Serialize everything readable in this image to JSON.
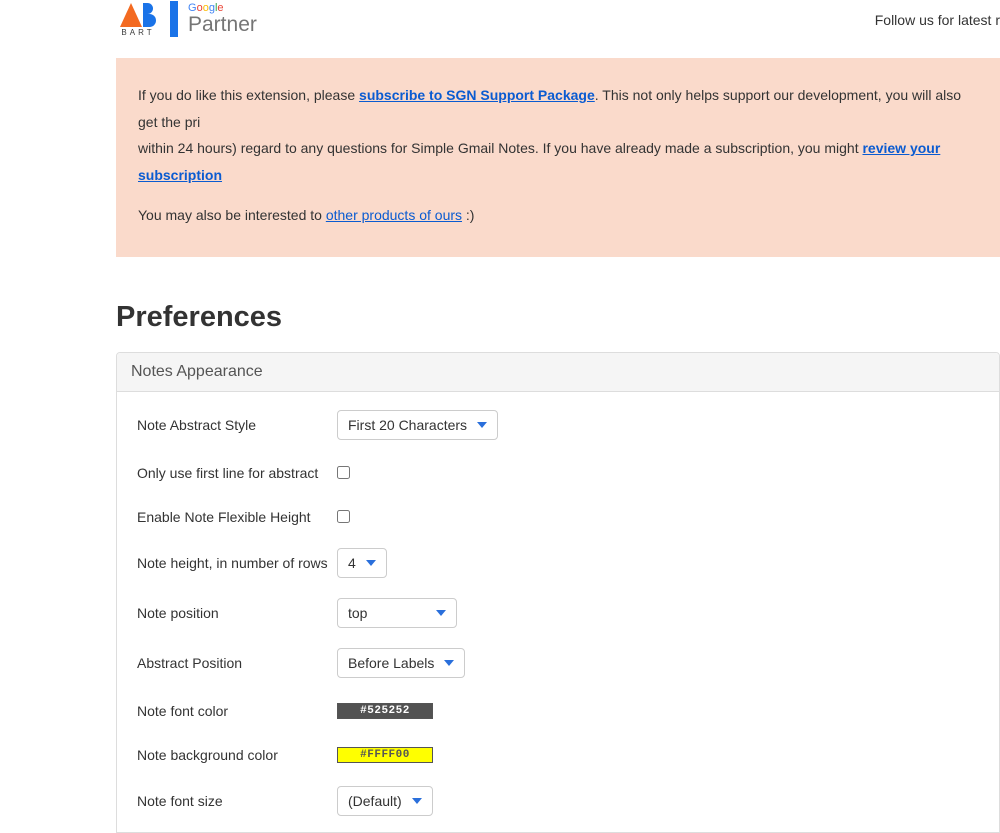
{
  "header": {
    "bart_label": "BART",
    "google_letters": [
      "G",
      "o",
      "o",
      "g",
      "l",
      "e"
    ],
    "partner_label": "Partner",
    "follow_text": "Follow us for latest r"
  },
  "banner": {
    "line1_pre": "If you do like this extension, please ",
    "subscribe_link": "subscribe to SGN Support Package",
    "line1_post": ". This not only helps support our development, you will also get the pri",
    "line2_pre": "within 24 hours) regard to any questions for Simple Gmail Notes. If you have already made a subscription, you might ",
    "review_link": "review your subscription",
    "line3_pre": "You may also be interested to ",
    "other_link": "other products of ours",
    "line3_post": " :)"
  },
  "prefs": {
    "title": "Preferences",
    "section_title": "Notes Appearance",
    "rows": {
      "abstract_style": {
        "label": "Note Abstract Style",
        "value": "First 20 Characters"
      },
      "first_line": {
        "label": "Only use first line for abstract",
        "checked": false
      },
      "flex_height": {
        "label": "Enable Note Flexible Height",
        "checked": false
      },
      "height_rows": {
        "label": "Note height, in number of rows",
        "value": "4"
      },
      "position": {
        "label": "Note position",
        "value": "top"
      },
      "abs_position": {
        "label": "Abstract Position",
        "value": "Before Labels"
      },
      "font_color": {
        "label": "Note font color",
        "value": "#525252"
      },
      "bg_color": {
        "label": "Note background color",
        "value": "#FFFF00"
      },
      "font_size": {
        "label": "Note font size",
        "value": "(Default)"
      }
    }
  }
}
